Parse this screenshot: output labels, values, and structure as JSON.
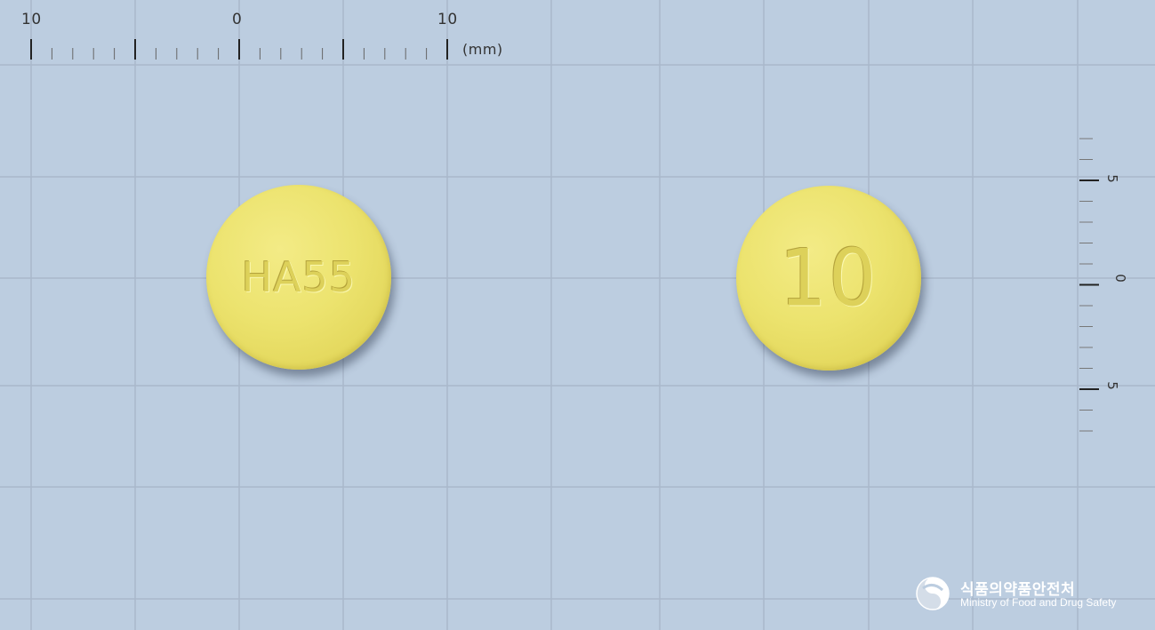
{
  "background_color": "#bccde0",
  "grid_line_color": "#a9b8cb",
  "top_ruler": {
    "labels": [
      "10",
      "0",
      "10"
    ],
    "unit": "(mm)"
  },
  "side_ruler": {
    "labels": [
      "5",
      "0",
      "5"
    ]
  },
  "pills": {
    "front": {
      "imprint": "HA55",
      "color": "#ece36e",
      "shape": "round"
    },
    "back": {
      "imprint": "10",
      "color": "#ece36e",
      "shape": "round"
    }
  },
  "logo": {
    "korean": "식품의약품안전처",
    "english": "Ministry of Food and Drug Safety"
  }
}
